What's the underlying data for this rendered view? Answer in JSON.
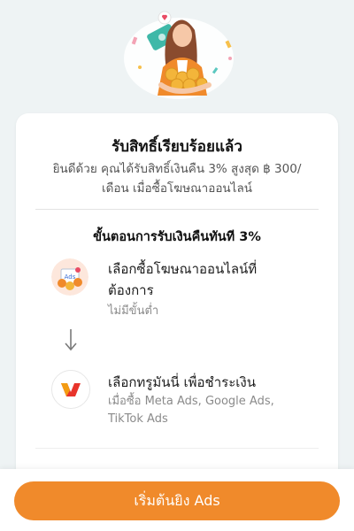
{
  "card": {
    "title": "รับสิทธิ์เรียบร้อยแล้ว",
    "subtitle_line1": "ยินดีด้วย คุณได้รับสิทธิ์เงินคืน 3% สูงสุด ฿ 300/",
    "subtitle_line2": "เดือน เมื่อซื้อโฆษณาออนไลน์",
    "steps_title": "ขั้นตอนการรับเงินคืนทันที 3%",
    "steps": [
      {
        "icon": "ads-coins-icon",
        "title_line1": "เลือกซื้อโฆษณาออนไลน์ที่",
        "title_line2": "ต้องการ",
        "desc_line1": "ไม่มีขั้นต่ำ",
        "badge": "Ads"
      },
      {
        "icon": "truemoney-wallet-icon",
        "title_line1": "เลือกทรูมันนี่ เพื่อชำระเงิน",
        "desc_line1": "เมื่อซื้อ Meta Ads, Google Ads,",
        "desc_line2": "TikTok Ads"
      }
    ]
  },
  "cta": {
    "label": "เริ่มต้นยิง Ads"
  },
  "colors": {
    "accent": "#f08a2b",
    "background": "#eef3f4",
    "card": "#ffffff"
  }
}
